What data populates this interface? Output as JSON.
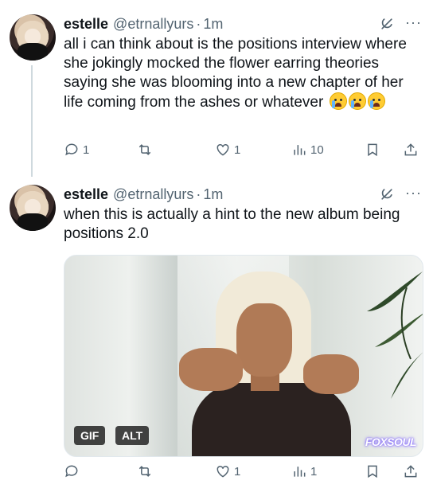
{
  "tweets": [
    {
      "author": {
        "name": "estelle",
        "handle": "@etrnallyurs"
      },
      "time": "1m",
      "separator": "·",
      "text": "all i can think about is the positions interview where she jokingly mocked the flower earring theories saying she was blooming into a new chapter of her life coming from the ashes or whatever",
      "emoji": [
        "loudly-crying-face",
        "loudly-crying-face",
        "loudly-crying-face"
      ],
      "stats": {
        "replies": "1",
        "retweets": "",
        "likes": "1",
        "views": "10"
      }
    },
    {
      "author": {
        "name": "estelle",
        "handle": "@etrnallyurs"
      },
      "time": "1m",
      "separator": "·",
      "text": "when this is actually a hint to the new album being positions 2.0",
      "media": {
        "type_badge": "GIF",
        "alt_badge": "ALT",
        "watermark": "FOXSOUL"
      },
      "stats": {
        "replies": "",
        "retweets": "",
        "likes": "1",
        "views": "1"
      }
    }
  ],
  "icons": {
    "reply": "reply-icon",
    "retweet": "retweet-icon",
    "like": "heart-icon",
    "views": "views-icon",
    "bookmark": "bookmark-icon",
    "share": "share-icon",
    "grok": "grok-icon",
    "more": "more-icon"
  },
  "more_label": "···",
  "colors": {
    "text": "#0f1419",
    "secondary": "#536471",
    "thread_line": "#cfd9de"
  }
}
